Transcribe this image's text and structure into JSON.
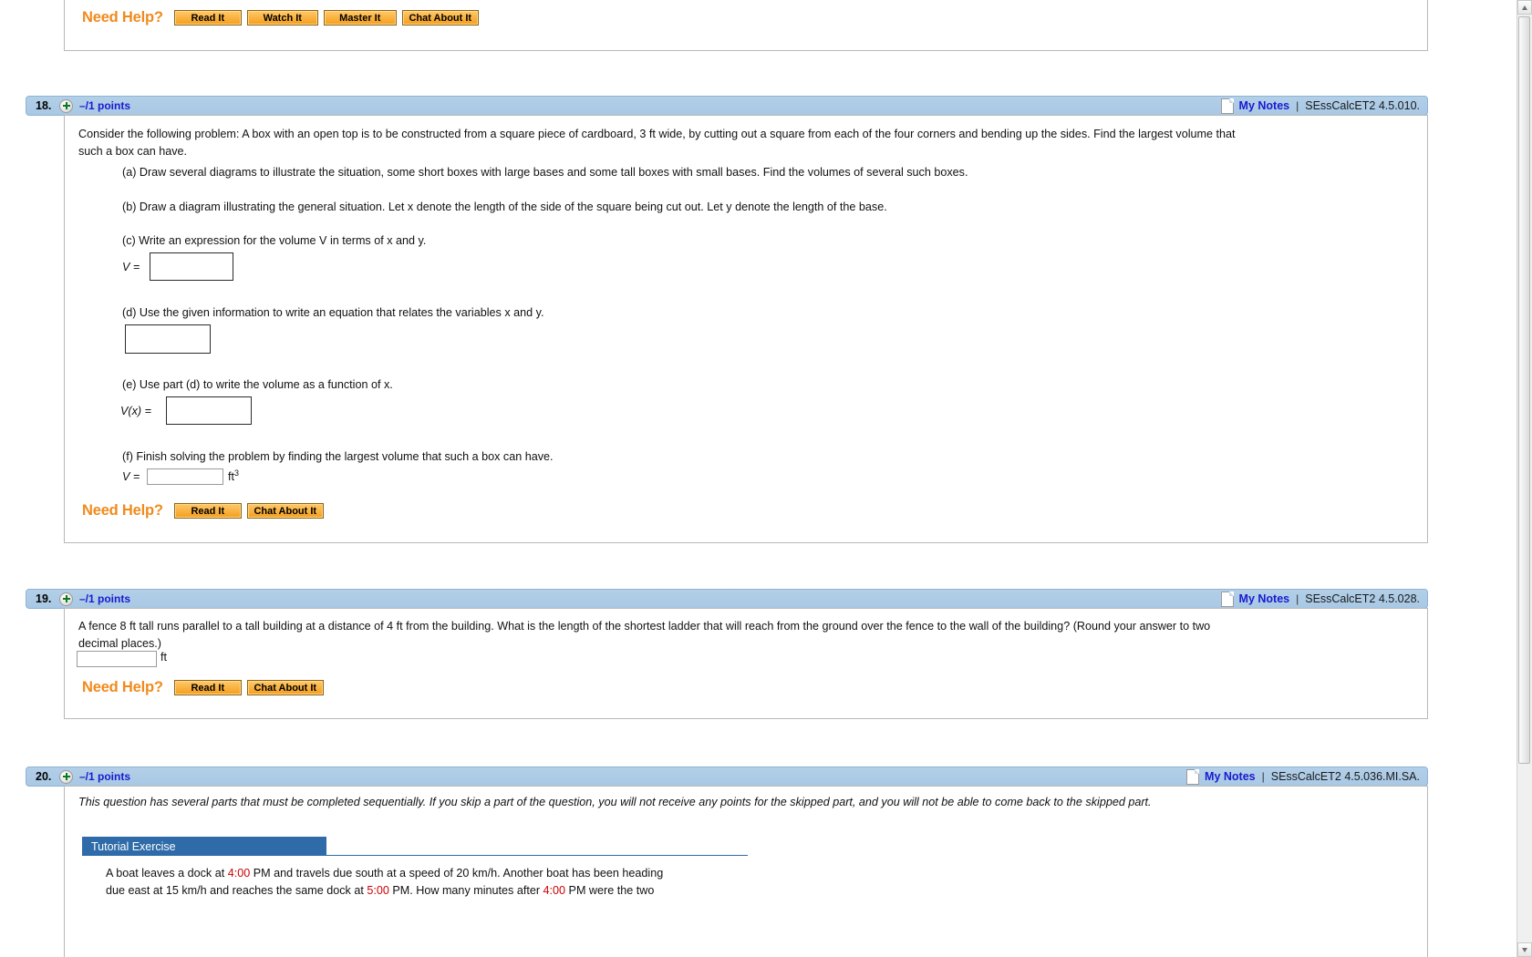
{
  "top_needhelp": {
    "label": "Need Help?",
    "buttons": [
      "Read It",
      "Watch It",
      "Master It",
      "Chat About It"
    ]
  },
  "questions": [
    {
      "number": "18.",
      "points": "–/1 points",
      "my_notes": "My Notes",
      "separator": "|",
      "code": "SEssCalcET2 4.5.010.",
      "stem_line1": "Consider the following problem: A box with an open top is to be constructed from a square piece of cardboard, 3 ft wide, by cutting out a square from each of the four corners and bending up the sides. Find the largest volume that",
      "stem_line2": "such a box can have.",
      "parts": [
        {
          "id": "a",
          "text": "(a) Draw several diagrams to illustrate the situation, some short boxes with large bases and some tall boxes with small bases. Find the volumes of several such boxes."
        },
        {
          "id": "b",
          "text": "(b) Draw a diagram illustrating the general situation. Let x denote the length of the side of the square being cut out. Let y denote the length of the base."
        },
        {
          "id": "c",
          "text": "(c) Write an expression for the volume V in terms of x and y."
        },
        {
          "id": "d",
          "text": "(d) Use the given information to write an equation that relates the variables x and y."
        },
        {
          "id": "e",
          "text": "(e) Use part (d) to write the volume as a function of x."
        },
        {
          "id": "f",
          "text": "(f) Finish solving the problem by finding the largest volume that such a box can have."
        }
      ],
      "labels": {
        "v_eq": "V =",
        "vx_eq": "V(x) =",
        "v_eq_f": "V =",
        "unit": "ft",
        "unit_sup": "3"
      },
      "inputs": {
        "c_value": "",
        "d_value": "",
        "e_value": "",
        "f_value": ""
      },
      "needhelp": {
        "label": "Need Help?",
        "buttons": [
          "Read It",
          "Chat About It"
        ]
      }
    },
    {
      "number": "19.",
      "points": "–/1 points",
      "my_notes": "My Notes",
      "separator": "|",
      "code": "SEssCalcET2 4.5.028.",
      "stem_line1": "A fence 8 ft tall runs parallel to a tall building at a distance of 4 ft from the building. What is the length of the shortest ladder that will reach from the ground over the fence to the wall of the building? (Round your answer to two",
      "stem_line2": "decimal places.)",
      "labels": {
        "unit": "ft"
      },
      "inputs": {
        "answer_value": ""
      },
      "needhelp": {
        "label": "Need Help?",
        "buttons": [
          "Read It",
          "Chat About It"
        ]
      }
    },
    {
      "number": "20.",
      "points": "–/1 points",
      "my_notes": "My Notes",
      "separator": "|",
      "code": "SEssCalcET2 4.5.036.MI.SA.",
      "sequential_notice": "This question has several parts that must be completed sequentially. If you skip a part of the question, you will not receive any points for the skipped part, and you will not be able to come back to the skipped part.",
      "tutorial_tab": "Tutorial Exercise",
      "tutorial_line1_pre": "A boat leaves a dock at ",
      "tutorial_line1_time": "4:00",
      "tutorial_line1_post": " PM and travels due south at a speed of 20 km/h. Another boat has been heading",
      "tutorial_line2_pre": "due east at 15 km/h and reaches the same dock at ",
      "tutorial_line2_time1": "5:00",
      "tutorial_line2_mid": " PM. How many minutes after ",
      "tutorial_line2_time2": "4:00",
      "tutorial_line2_post": " PM were the two"
    }
  ],
  "colors": {
    "header_blue": "#a8c8e4",
    "points_blue": "#1a1ad0",
    "orange": "#f08a1c",
    "tutorial_blue": "#2e6ba8",
    "red_time": "#cc0000"
  }
}
